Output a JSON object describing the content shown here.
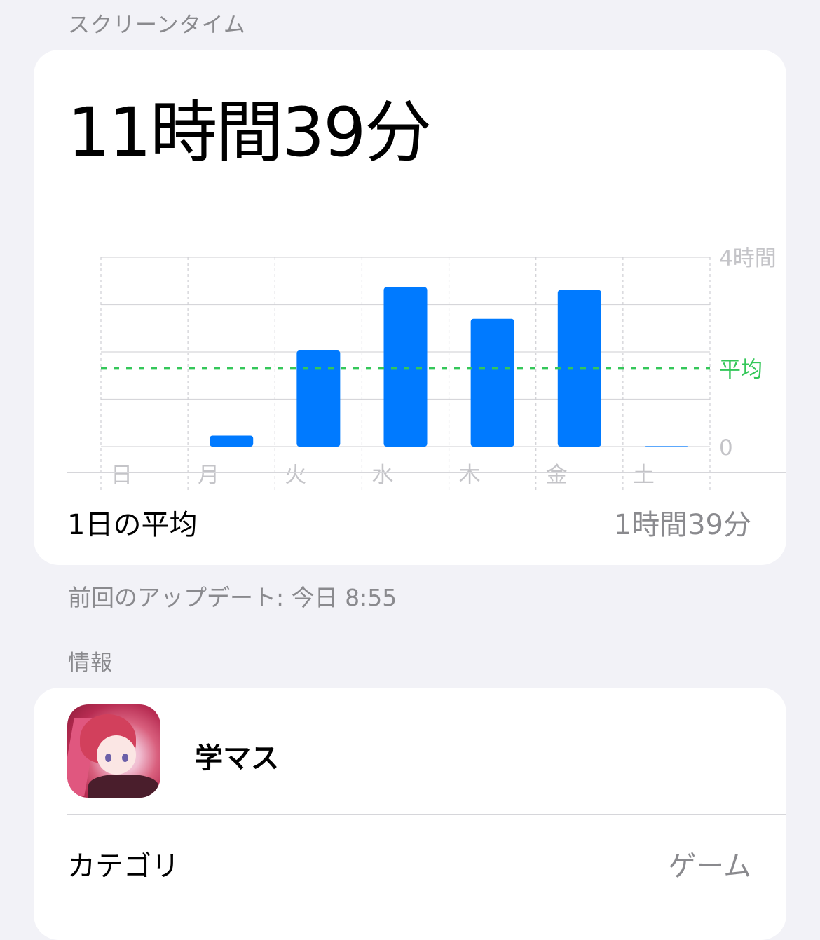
{
  "screen_time": {
    "header": "スクリーンタイム",
    "total": "11時間39分",
    "daily_average_label": "1日の平均",
    "daily_average_value": "1時間39分",
    "last_update": "前回のアップデート: 今日 8:55"
  },
  "chart_data": {
    "type": "bar",
    "categories": [
      "日",
      "月",
      "火",
      "水",
      "木",
      "金",
      "土"
    ],
    "values": [
      0,
      0.23,
      2.03,
      3.37,
      2.7,
      3.31,
      0.01
    ],
    "ylim": [
      0,
      4
    ],
    "y_ticks": [
      "4時間",
      "0"
    ],
    "average": 1.65,
    "average_label": "平均",
    "grid": true,
    "bar_color": "#007aff",
    "average_color": "#34c759"
  },
  "info": {
    "header": "情報",
    "app_name": "学マス",
    "category_label": "カテゴリ",
    "category_value": "ゲーム"
  }
}
